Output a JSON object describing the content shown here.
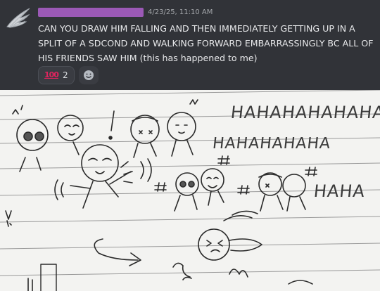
{
  "message": {
    "timestamp": "4/23/25, 11:10 AM",
    "text": "CAN YOU DRAW HIM FALLING AND THEN IMMEDIATELY GETTING UP IN A SPLIT OF A SDCOND AND WALKING FORWARD EMBARRASSINGLY BC ALL OF HIS FRIENDS SAW HIM (this has happened to me)",
    "name_bar_color": "#9b59b6"
  },
  "reactions": [
    {
      "icon": "hundred-points-emoji",
      "emoji_text": "100",
      "count": "2"
    }
  ],
  "add_reaction_icon": "smiley-add-reaction-icon",
  "drawing": {
    "laugh_large": "HAHAHAHAHAHA",
    "laugh_medium": "HAHAHAHAHA",
    "laugh_small": "HAHA"
  }
}
